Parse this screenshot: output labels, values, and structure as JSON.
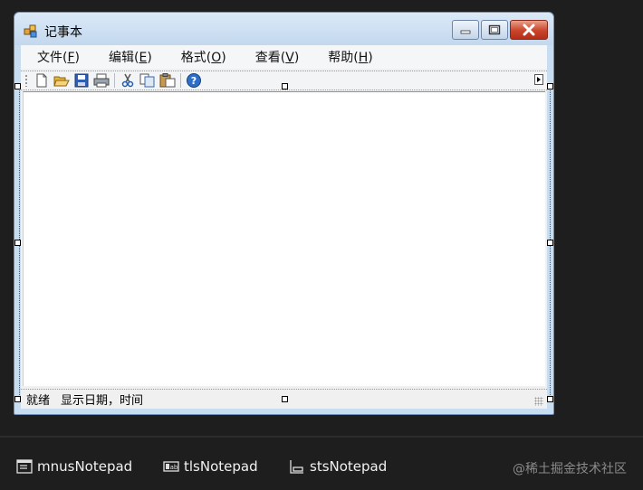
{
  "window": {
    "title": "记事本"
  },
  "menu": [
    {
      "label": "文件",
      "accel": "F"
    },
    {
      "label": "编辑",
      "accel": "E"
    },
    {
      "label": "格式",
      "accel": "O"
    },
    {
      "label": "查看",
      "accel": "V"
    },
    {
      "label": "帮助",
      "accel": "H"
    }
  ],
  "toolbar": {
    "icons": [
      "new-icon",
      "open-icon",
      "save-icon",
      "print-icon",
      "cut-icon",
      "copy-icon",
      "paste-icon",
      "help-icon"
    ]
  },
  "statusbar": {
    "status": "就绪",
    "datetime": "显示日期，时间"
  },
  "tray": {
    "items": [
      {
        "label": "mnusNotepad",
        "icon": "menustrip-icon"
      },
      {
        "label": "tlsNotepad",
        "icon": "toolstrip-icon"
      },
      {
        "label": "stsNotepad",
        "icon": "statusstrip-icon"
      }
    ],
    "watermark": "@稀土掘金技术社区"
  }
}
